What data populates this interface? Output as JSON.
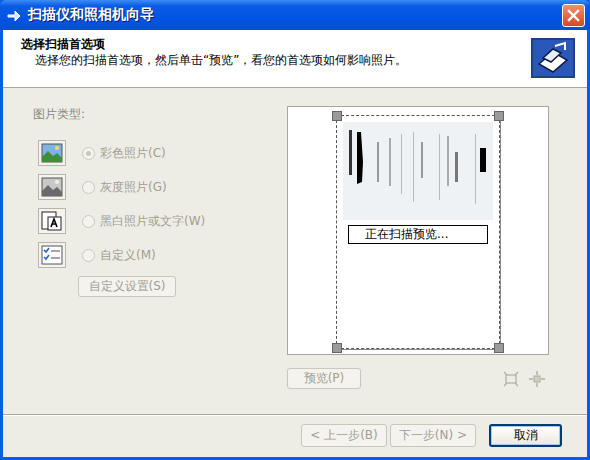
{
  "window": {
    "title": "扫描仪和照相机向导"
  },
  "header": {
    "title": "选择扫描首选项",
    "subtitle": "选择您的扫描首选项，然后单击“预览”，看您的首选项如何影响照片。"
  },
  "picture_type": {
    "label": "图片类型:",
    "options": [
      {
        "label": "彩色照片(C)",
        "kind": "color",
        "selected": true,
        "disabled": true
      },
      {
        "label": "灰度照片(G)",
        "kind": "gray",
        "selected": false,
        "disabled": true
      },
      {
        "label": "黑白照片或文字(W)",
        "kind": "bw",
        "selected": false,
        "disabled": true
      },
      {
        "label": "自定义(M)",
        "kind": "custom",
        "selected": false,
        "disabled": true
      }
    ]
  },
  "custom_settings": {
    "label": "自定义设置(S)",
    "disabled": true
  },
  "preview": {
    "status": "正在扫描预览...",
    "button": {
      "label": "预览(P)",
      "disabled": true
    }
  },
  "buttons": [
    {
      "label": "< 上一步(B)",
      "disabled": true,
      "default": false
    },
    {
      "label": "下一步(N) >",
      "disabled": true,
      "default": false
    },
    {
      "label": "取消",
      "disabled": false,
      "default": true
    }
  ]
}
